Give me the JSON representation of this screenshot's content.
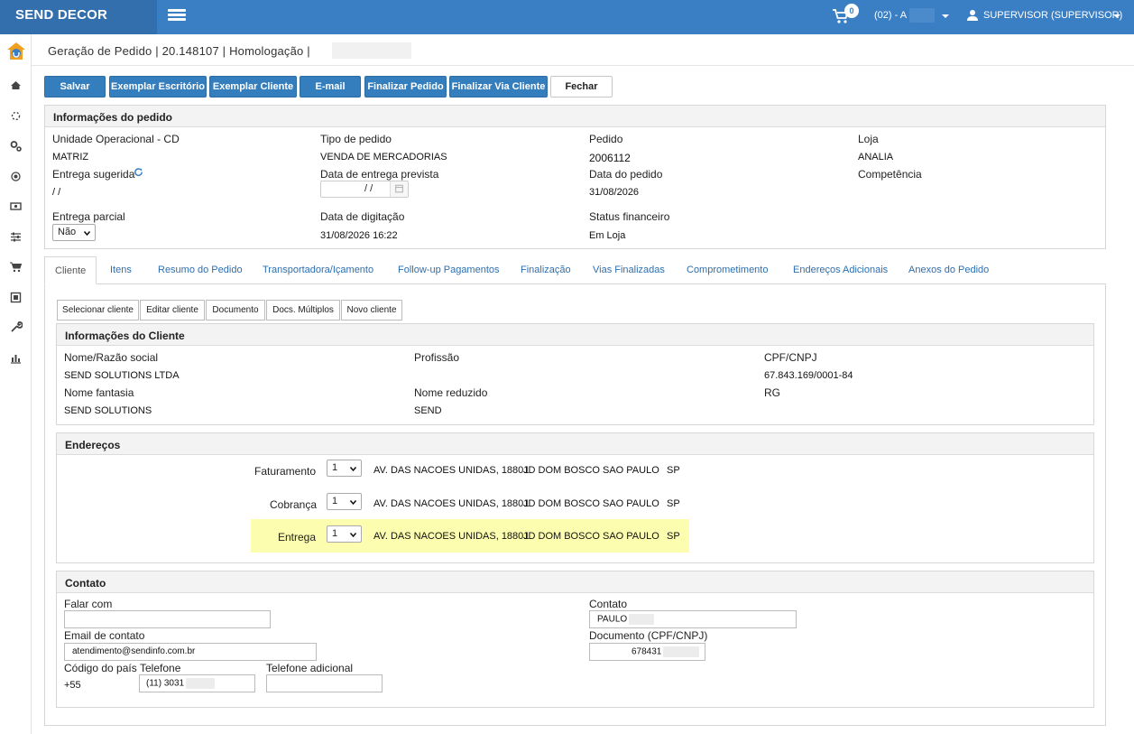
{
  "app": {
    "brand": "SEND DECOR",
    "cart_count": "0",
    "store_selector": "(02) - A",
    "user": "SUPERVISOR (SUPERVISOR)"
  },
  "breadcrumb": "Geração de Pedido | 20.148107 | Homologação |",
  "toolbar": {
    "salvar": "Salvar",
    "exemplar_escritorio": "Exemplar Escritório",
    "exemplar_cliente": "Exemplar Cliente",
    "email": "E-mail",
    "finalizar_pedido": "Finalizar Pedido",
    "finalizar_via_cliente": "Finalizar Via Cliente",
    "fechar": "Fechar"
  },
  "pedido": {
    "title": "Informações do pedido",
    "unidade_label": "Unidade Operacional - CD",
    "unidade_value": "MATRIZ",
    "tipo_label": "Tipo de pedido",
    "tipo_value": "VENDA DE MERCADORIAS",
    "pedido_label": "Pedido",
    "pedido_value": "2006112",
    "loja_label": "Loja",
    "loja_value": "ANALIA",
    "entrega_sugerida_label": "Entrega sugerida",
    "entrega_sugerida_value": "/ /",
    "data_entrega_prevista_label": "Data de entrega prevista",
    "data_entrega_prevista_value": "/ /",
    "data_pedido_label": "Data do pedido",
    "data_pedido_value": "31/08/2026",
    "competencia_label": "Competência",
    "entrega_parcial_label": "Entrega parcial",
    "entrega_parcial_value": "Não",
    "data_digitacao_label": "Data de digitação",
    "data_digitacao_value": "31/08/2026 16:22",
    "status_financeiro_label": "Status financeiro",
    "status_financeiro_value": "Em Loja"
  },
  "tabs": [
    {
      "label": "Cliente"
    },
    {
      "label": "Itens"
    },
    {
      "label": "Resumo do Pedido"
    },
    {
      "label": "Transportadora/Içamento"
    },
    {
      "label": "Follow-up Pagamentos"
    },
    {
      "label": "Finalização"
    },
    {
      "label": "Vias Finalizadas"
    },
    {
      "label": "Comprometimento"
    },
    {
      "label": "Endereços Adicionais"
    },
    {
      "label": "Anexos do Pedido"
    }
  ],
  "cliente_buttons": {
    "selecionar": "Selecionar cliente",
    "editar": "Editar cliente",
    "documento": "Documento",
    "docs_multiplos": "Docs. Múltiplos",
    "novo": "Novo cliente"
  },
  "cliente": {
    "title": "Informações do Cliente",
    "nome_label": "Nome/Razão social",
    "nome_value": "SEND SOLUTIONS LTDA",
    "profissao_label": "Profissão",
    "cpf_label": "CPF/CNPJ",
    "cpf_value": "67.843.169/0001-84",
    "fantasia_label": "Nome fantasia",
    "fantasia_value": "SEND SOLUTIONS",
    "reduzido_label": "Nome reduzido",
    "reduzido_value": "SEND",
    "rg_label": "RG"
  },
  "enderecos": {
    "title": "Endereços",
    "rows": [
      {
        "tipo": "Faturamento",
        "num": "1",
        "logradouro": "AV. DAS NACOES UNIDAS, 18801",
        "bairro": "JD DOM BOSCO",
        "cidade": "SAO PAULO",
        "uf": "SP"
      },
      {
        "tipo": "Cobrança",
        "num": "1",
        "logradouro": "AV. DAS NACOES UNIDAS, 18801",
        "bairro": "JD DOM BOSCO",
        "cidade": "SAO PAULO",
        "uf": "SP"
      },
      {
        "tipo": "Entrega",
        "num": "1",
        "logradouro": "AV. DAS NACOES UNIDAS, 18801",
        "bairro": "JD DOM BOSCO",
        "cidade": "SAO PAULO",
        "uf": "SP"
      }
    ]
  },
  "contato": {
    "title": "Contato",
    "falar_com_label": "Falar com",
    "falar_com_value": "",
    "contato_label": "Contato",
    "contato_value": "PAULO",
    "email_label": "Email de contato",
    "email_value": "atendimento@sendinfo.com.br",
    "documento_label": "Documento (CPF/CNPJ)",
    "documento_value": "678431",
    "codigo_pais_label": "Código do país",
    "codigo_pais_value": "+55",
    "telefone_label": "Telefone",
    "telefone_value": "(11) 3031",
    "telefone_adicional_label": "Telefone adicional",
    "telefone_adicional_value": ""
  },
  "colors": {
    "topbar": "#3a7fc4",
    "brand_bg": "#346fad",
    "button_blue": "#357ebd",
    "link_blue": "#2c6fb0",
    "highlight": "#fdfdb0"
  },
  "icons": {
    "menu": "hamburger-icon",
    "cart": "cart-icon",
    "user": "user-icon",
    "refresh": "refresh-icon",
    "calendar": "calendar-icon"
  }
}
